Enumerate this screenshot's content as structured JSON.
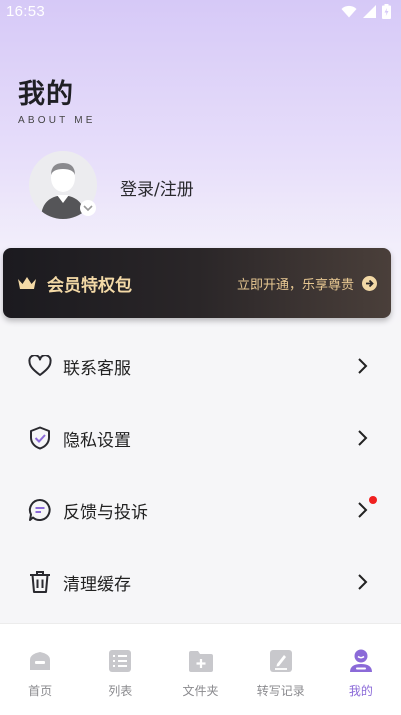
{
  "status_bar": {
    "time": "16:53"
  },
  "header": {
    "title": "我的",
    "subtitle": "ABOUT ME"
  },
  "profile": {
    "login_label": "登录/注册"
  },
  "vip": {
    "title": "会员特权包",
    "cta": "立即开通，乐享尊贵"
  },
  "menu": {
    "items": [
      {
        "label": "联系客服",
        "icon": "heart-icon"
      },
      {
        "label": "隐私设置",
        "icon": "shield-icon"
      },
      {
        "label": "反馈与投诉",
        "icon": "chat-bubble-icon",
        "has_notification": true
      },
      {
        "label": "清理缓存",
        "icon": "trash-icon"
      }
    ]
  },
  "tabbar": {
    "items": [
      {
        "label": "首页",
        "icon": "home-icon",
        "active": false
      },
      {
        "label": "列表",
        "icon": "list-icon",
        "active": false
      },
      {
        "label": "文件夹",
        "icon": "folder-add-icon",
        "active": false
      },
      {
        "label": "转写记录",
        "icon": "edit-record-icon",
        "active": false
      },
      {
        "label": "我的",
        "icon": "user-icon",
        "active": true
      }
    ]
  },
  "colors": {
    "accent": "#8b6ad8",
    "vip_gold": "#f3d9a6",
    "notification_red": "#f02020"
  }
}
